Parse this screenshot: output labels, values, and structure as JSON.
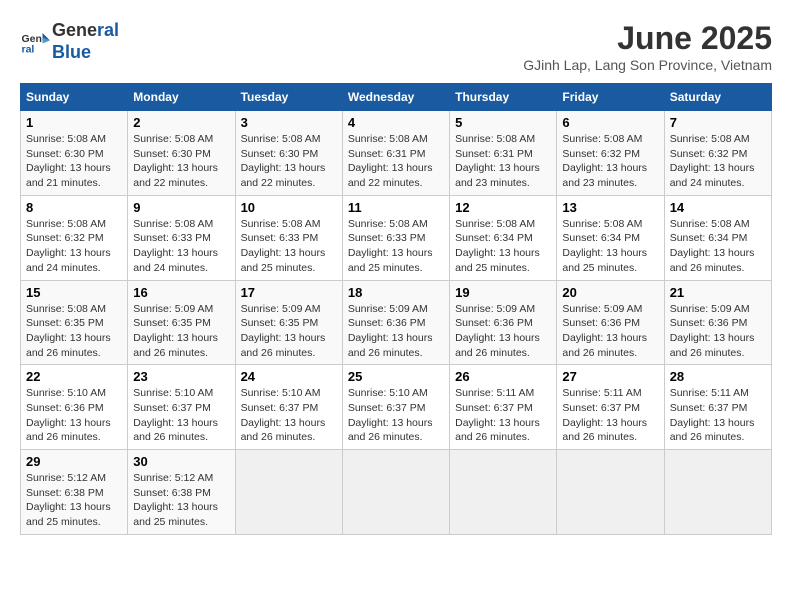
{
  "logo": {
    "line1": "General",
    "line2": "Blue"
  },
  "title": "June 2025",
  "subtitle": "GJinh Lap, Lang Son Province, Vietnam",
  "days_of_week": [
    "Sunday",
    "Monday",
    "Tuesday",
    "Wednesday",
    "Thursday",
    "Friday",
    "Saturday"
  ],
  "weeks": [
    [
      {
        "day": "1",
        "info": "Sunrise: 5:08 AM\nSunset: 6:30 PM\nDaylight: 13 hours\nand 21 minutes."
      },
      {
        "day": "2",
        "info": "Sunrise: 5:08 AM\nSunset: 6:30 PM\nDaylight: 13 hours\nand 22 minutes."
      },
      {
        "day": "3",
        "info": "Sunrise: 5:08 AM\nSunset: 6:30 PM\nDaylight: 13 hours\nand 22 minutes."
      },
      {
        "day": "4",
        "info": "Sunrise: 5:08 AM\nSunset: 6:31 PM\nDaylight: 13 hours\nand 22 minutes."
      },
      {
        "day": "5",
        "info": "Sunrise: 5:08 AM\nSunset: 6:31 PM\nDaylight: 13 hours\nand 23 minutes."
      },
      {
        "day": "6",
        "info": "Sunrise: 5:08 AM\nSunset: 6:32 PM\nDaylight: 13 hours\nand 23 minutes."
      },
      {
        "day": "7",
        "info": "Sunrise: 5:08 AM\nSunset: 6:32 PM\nDaylight: 13 hours\nand 24 minutes."
      }
    ],
    [
      {
        "day": "8",
        "info": "Sunrise: 5:08 AM\nSunset: 6:32 PM\nDaylight: 13 hours\nand 24 minutes."
      },
      {
        "day": "9",
        "info": "Sunrise: 5:08 AM\nSunset: 6:33 PM\nDaylight: 13 hours\nand 24 minutes."
      },
      {
        "day": "10",
        "info": "Sunrise: 5:08 AM\nSunset: 6:33 PM\nDaylight: 13 hours\nand 25 minutes."
      },
      {
        "day": "11",
        "info": "Sunrise: 5:08 AM\nSunset: 6:33 PM\nDaylight: 13 hours\nand 25 minutes."
      },
      {
        "day": "12",
        "info": "Sunrise: 5:08 AM\nSunset: 6:34 PM\nDaylight: 13 hours\nand 25 minutes."
      },
      {
        "day": "13",
        "info": "Sunrise: 5:08 AM\nSunset: 6:34 PM\nDaylight: 13 hours\nand 25 minutes."
      },
      {
        "day": "14",
        "info": "Sunrise: 5:08 AM\nSunset: 6:34 PM\nDaylight: 13 hours\nand 26 minutes."
      }
    ],
    [
      {
        "day": "15",
        "info": "Sunrise: 5:08 AM\nSunset: 6:35 PM\nDaylight: 13 hours\nand 26 minutes."
      },
      {
        "day": "16",
        "info": "Sunrise: 5:09 AM\nSunset: 6:35 PM\nDaylight: 13 hours\nand 26 minutes."
      },
      {
        "day": "17",
        "info": "Sunrise: 5:09 AM\nSunset: 6:35 PM\nDaylight: 13 hours\nand 26 minutes."
      },
      {
        "day": "18",
        "info": "Sunrise: 5:09 AM\nSunset: 6:36 PM\nDaylight: 13 hours\nand 26 minutes."
      },
      {
        "day": "19",
        "info": "Sunrise: 5:09 AM\nSunset: 6:36 PM\nDaylight: 13 hours\nand 26 minutes."
      },
      {
        "day": "20",
        "info": "Sunrise: 5:09 AM\nSunset: 6:36 PM\nDaylight: 13 hours\nand 26 minutes."
      },
      {
        "day": "21",
        "info": "Sunrise: 5:09 AM\nSunset: 6:36 PM\nDaylight: 13 hours\nand 26 minutes."
      }
    ],
    [
      {
        "day": "22",
        "info": "Sunrise: 5:10 AM\nSunset: 6:36 PM\nDaylight: 13 hours\nand 26 minutes."
      },
      {
        "day": "23",
        "info": "Sunrise: 5:10 AM\nSunset: 6:37 PM\nDaylight: 13 hours\nand 26 minutes."
      },
      {
        "day": "24",
        "info": "Sunrise: 5:10 AM\nSunset: 6:37 PM\nDaylight: 13 hours\nand 26 minutes."
      },
      {
        "day": "25",
        "info": "Sunrise: 5:10 AM\nSunset: 6:37 PM\nDaylight: 13 hours\nand 26 minutes."
      },
      {
        "day": "26",
        "info": "Sunrise: 5:11 AM\nSunset: 6:37 PM\nDaylight: 13 hours\nand 26 minutes."
      },
      {
        "day": "27",
        "info": "Sunrise: 5:11 AM\nSunset: 6:37 PM\nDaylight: 13 hours\nand 26 minutes."
      },
      {
        "day": "28",
        "info": "Sunrise: 5:11 AM\nSunset: 6:37 PM\nDaylight: 13 hours\nand 26 minutes."
      }
    ],
    [
      {
        "day": "29",
        "info": "Sunrise: 5:12 AM\nSunset: 6:38 PM\nDaylight: 13 hours\nand 25 minutes."
      },
      {
        "day": "30",
        "info": "Sunrise: 5:12 AM\nSunset: 6:38 PM\nDaylight: 13 hours\nand 25 minutes."
      },
      {
        "day": "",
        "info": ""
      },
      {
        "day": "",
        "info": ""
      },
      {
        "day": "",
        "info": ""
      },
      {
        "day": "",
        "info": ""
      },
      {
        "day": "",
        "info": ""
      }
    ]
  ]
}
